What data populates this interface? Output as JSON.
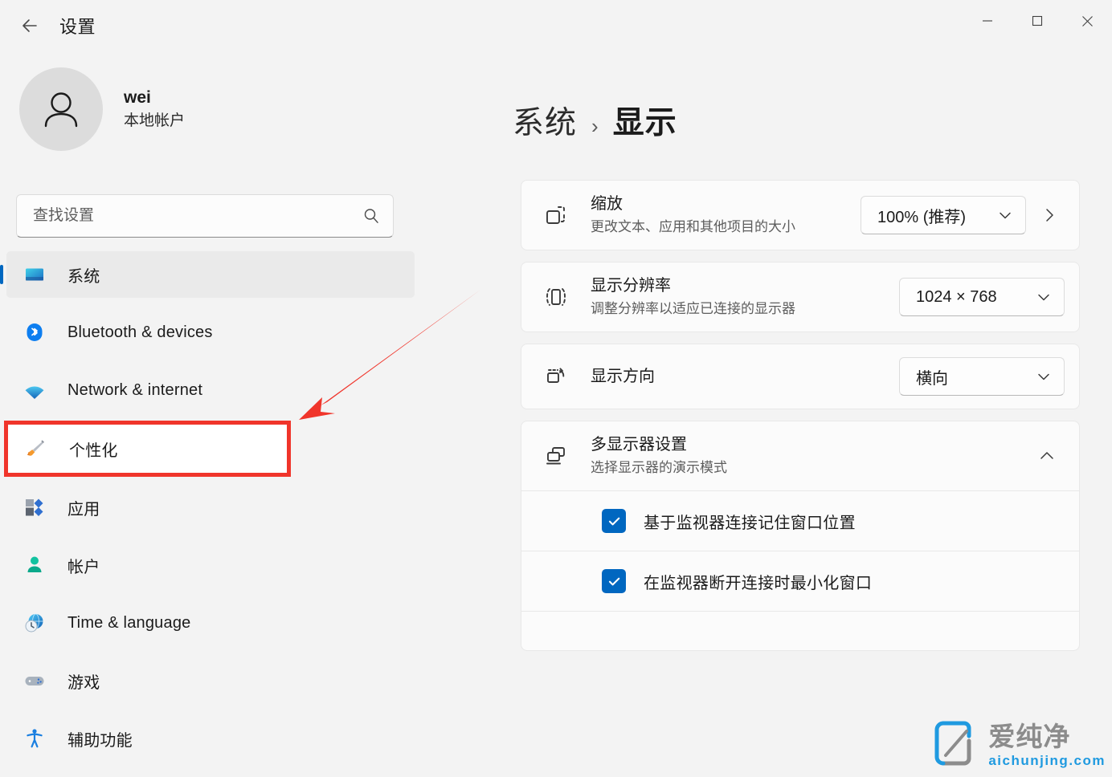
{
  "window": {
    "title": "设置",
    "back_label": "back-arrow",
    "controls": {
      "minimize": "─",
      "maximize": "☐",
      "close": "✕"
    }
  },
  "sidebar": {
    "account": {
      "name": "wei",
      "type": "本地帐户"
    },
    "search": {
      "placeholder": "查找设置",
      "value": ""
    },
    "items": [
      {
        "label": "系统",
        "icon": "monitor-icon",
        "selected": true,
        "annotated": false
      },
      {
        "label": "Bluetooth & devices",
        "icon": "bluetooth-icon",
        "selected": false,
        "annotated": false
      },
      {
        "label": "Network & internet",
        "icon": "wifi-icon",
        "selected": false,
        "annotated": false
      },
      {
        "label": "个性化",
        "icon": "brush-icon",
        "selected": false,
        "annotated": true
      },
      {
        "label": "应用",
        "icon": "apps-icon",
        "selected": false,
        "annotated": false
      },
      {
        "label": "帐户",
        "icon": "account-icon",
        "selected": false,
        "annotated": false
      },
      {
        "label": "Time & language",
        "icon": "clock-globe-icon",
        "selected": false,
        "annotated": false
      },
      {
        "label": "游戏",
        "icon": "gamepad-icon",
        "selected": false,
        "annotated": false
      },
      {
        "label": "辅助功能",
        "icon": "accessibility-icon",
        "selected": false,
        "annotated": false
      }
    ]
  },
  "main": {
    "breadcrumb": {
      "parent": "系统",
      "separator": "›",
      "current": "显示"
    },
    "cards": [
      {
        "id": "scale",
        "icon": "scale-icon",
        "title": "缩放",
        "subtitle": "更改文本、应用和其他项目的大小",
        "control": "combo",
        "value": "100% (推荐)",
        "has_chevron_right": true
      },
      {
        "id": "resolution",
        "icon": "resolution-icon",
        "title": "显示分辨率",
        "subtitle": "调整分辨率以适应已连接的显示器",
        "control": "combo",
        "value": "1024 × 768",
        "has_chevron_right": false
      },
      {
        "id": "orientation",
        "icon": "orientation-icon",
        "title": "显示方向",
        "subtitle": "",
        "control": "combo",
        "value": "横向",
        "has_chevron_right": false
      },
      {
        "id": "multi-display",
        "icon": "multi-monitor-icon",
        "title": "多显示器设置",
        "subtitle": "选择显示器的演示模式",
        "control": "expander",
        "expanded": true,
        "checkboxes": [
          {
            "label": "基于监视器连接记住窗口位置",
            "checked": true
          },
          {
            "label": "在监视器断开连接时最小化窗口",
            "checked": true
          }
        ]
      }
    ]
  },
  "annotations": {
    "highlight_color": "#f0352b",
    "arrow_color": "#f0352b",
    "highlighted_item": "个性化"
  },
  "watermark": {
    "cn": "爱纯净",
    "en": "aichunjing.com",
    "accent": "#1f9ae0"
  },
  "colors": {
    "page_bg": "#f3f3f3",
    "card_bg": "#fbfbfb",
    "accent": "#0067c0",
    "selected_nav_bg": "#eaeaea"
  }
}
